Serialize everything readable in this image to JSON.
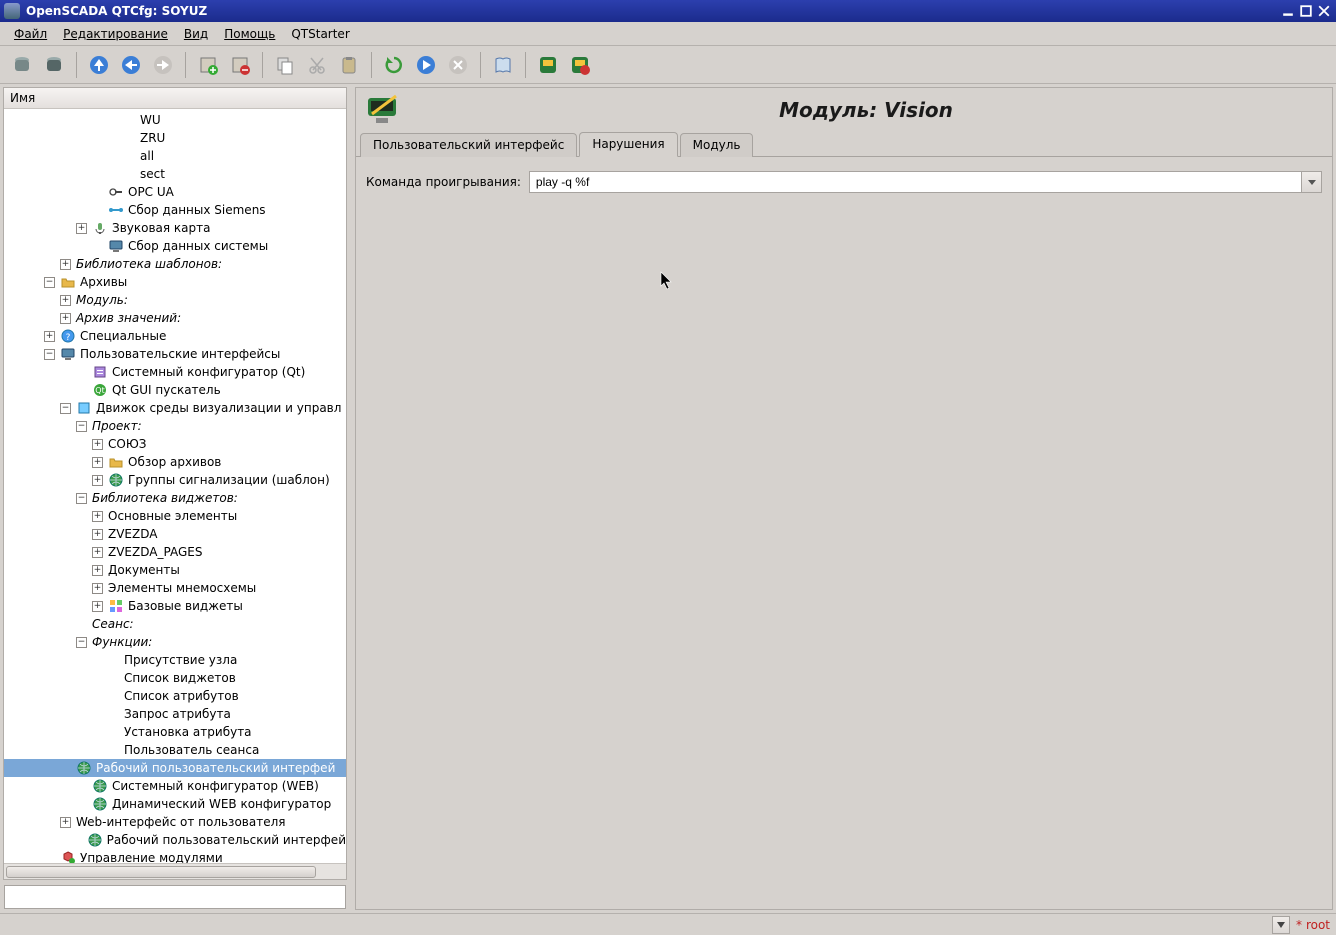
{
  "window": {
    "title": "OpenSCADA QTCfg: SOYUZ"
  },
  "menu": {
    "file": "Файл",
    "edit": "Редактирование",
    "view": "Вид",
    "help": "Помощь",
    "qtstarter": "QTStarter"
  },
  "tree": {
    "header": "Имя",
    "items": [
      {
        "label": "WU",
        "indent": 7,
        "exp": ""
      },
      {
        "label": "ZRU",
        "indent": 7,
        "exp": ""
      },
      {
        "label": "all",
        "indent": 7,
        "exp": ""
      },
      {
        "label": "sect",
        "indent": 7,
        "exp": ""
      },
      {
        "label": "OPC UA",
        "indent": 5,
        "exp": "",
        "icon": "key"
      },
      {
        "label": "Сбор данных Siemens",
        "indent": 5,
        "exp": "",
        "icon": "net"
      },
      {
        "label": "Звуковая карта",
        "indent": 4,
        "exp": "+",
        "icon": "mic"
      },
      {
        "label": "Сбор данных системы",
        "indent": 5,
        "exp": "",
        "icon": "mon"
      },
      {
        "label": "Библиотека шаблонов:",
        "indent": 3,
        "exp": "+",
        "italic": true
      },
      {
        "label": "Архивы",
        "indent": 2,
        "exp": "-",
        "icon": "folder"
      },
      {
        "label": "Модуль:",
        "indent": 3,
        "exp": "+",
        "italic": true
      },
      {
        "label": "Архив значений:",
        "indent": 3,
        "exp": "+",
        "italic": true
      },
      {
        "label": "Специальные",
        "indent": 2,
        "exp": "+",
        "icon": "help"
      },
      {
        "label": "Пользовательские интерфейсы",
        "indent": 2,
        "exp": "-",
        "icon": "mon"
      },
      {
        "label": "Системный конфигуратор (Qt)",
        "indent": 4,
        "exp": "",
        "icon": "cfg"
      },
      {
        "label": "Qt GUI пускатель",
        "indent": 4,
        "exp": "",
        "icon": "qt"
      },
      {
        "label": "Движок среды визуализации и управл",
        "indent": 3,
        "exp": "-",
        "icon": "vis"
      },
      {
        "label": "Проект:",
        "indent": 4,
        "exp": "-",
        "italic": true
      },
      {
        "label": "СОЮЗ",
        "indent": 5,
        "exp": "+"
      },
      {
        "label": "Обзор архивов",
        "indent": 5,
        "exp": "+",
        "icon": "folder"
      },
      {
        "label": "Группы сигнализации (шаблон)",
        "indent": 5,
        "exp": "+",
        "icon": "globe"
      },
      {
        "label": "Библиотека виджетов:",
        "indent": 4,
        "exp": "-",
        "italic": true
      },
      {
        "label": "Основные элементы",
        "indent": 5,
        "exp": "+"
      },
      {
        "label": "ZVEZDA",
        "indent": 5,
        "exp": "+"
      },
      {
        "label": "ZVEZDA_PAGES",
        "indent": 5,
        "exp": "+"
      },
      {
        "label": "Документы",
        "indent": 5,
        "exp": "+"
      },
      {
        "label": "Элементы мнемосхемы",
        "indent": 5,
        "exp": "+"
      },
      {
        "label": "Базовые виджеты",
        "indent": 5,
        "exp": "+",
        "icon": "widgets"
      },
      {
        "label": "Сеанс:",
        "indent": 4,
        "exp": "",
        "italic": true
      },
      {
        "label": "Функции:",
        "indent": 4,
        "exp": "-",
        "italic": true
      },
      {
        "label": "Присутствие узла",
        "indent": 6,
        "exp": ""
      },
      {
        "label": "Список виджетов",
        "indent": 6,
        "exp": ""
      },
      {
        "label": "Список атрибутов",
        "indent": 6,
        "exp": ""
      },
      {
        "label": "Запрос атрибута",
        "indent": 6,
        "exp": ""
      },
      {
        "label": "Установка атрибута",
        "indent": 6,
        "exp": ""
      },
      {
        "label": "Пользователь сеанса",
        "indent": 6,
        "exp": ""
      },
      {
        "label": "Рабочий пользовательский интерфей",
        "indent": 3,
        "exp": "",
        "icon": "globe",
        "selected": true
      },
      {
        "label": "Системный конфигуратор (WEB)",
        "indent": 4,
        "exp": "",
        "icon": "globe"
      },
      {
        "label": "Динамический WEB конфигуратор",
        "indent": 4,
        "exp": "",
        "icon": "globe"
      },
      {
        "label": "Web-интерфейс от пользователя",
        "indent": 3,
        "exp": "+"
      },
      {
        "label": "Рабочий пользовательский интерфей",
        "indent": 4,
        "exp": "",
        "icon": "globe"
      },
      {
        "label": "Управление модулями",
        "indent": 2,
        "exp": "",
        "icon": "mods"
      }
    ]
  },
  "page": {
    "title": "Модуль: Vision",
    "tabs": {
      "t1": "Пользовательский интерфейс",
      "t2": "Нарушения",
      "t3": "Модуль",
      "active": 1
    },
    "form": {
      "play_label": "Команда проигрывания:",
      "play_value": "play -q %f"
    }
  },
  "status": {
    "star": "*",
    "user": "root"
  }
}
